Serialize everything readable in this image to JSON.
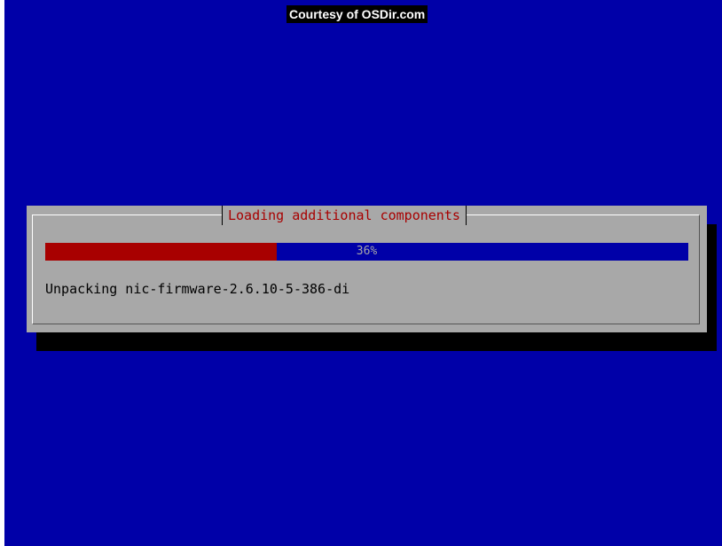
{
  "watermark": {
    "text": "Courtesy of OSDir.com"
  },
  "dialog": {
    "title": "Loading additional components",
    "progress": {
      "percent": 36,
      "label": "36%"
    },
    "status": "Unpacking nic-firmware-2.6.10-5-386-di"
  },
  "colors": {
    "background": "#0000a8",
    "dialog": "#a8a8a8",
    "title": "#a80000",
    "progress_fill": "#a80000",
    "progress_track": "#0000a8",
    "shadow": "#000000"
  }
}
